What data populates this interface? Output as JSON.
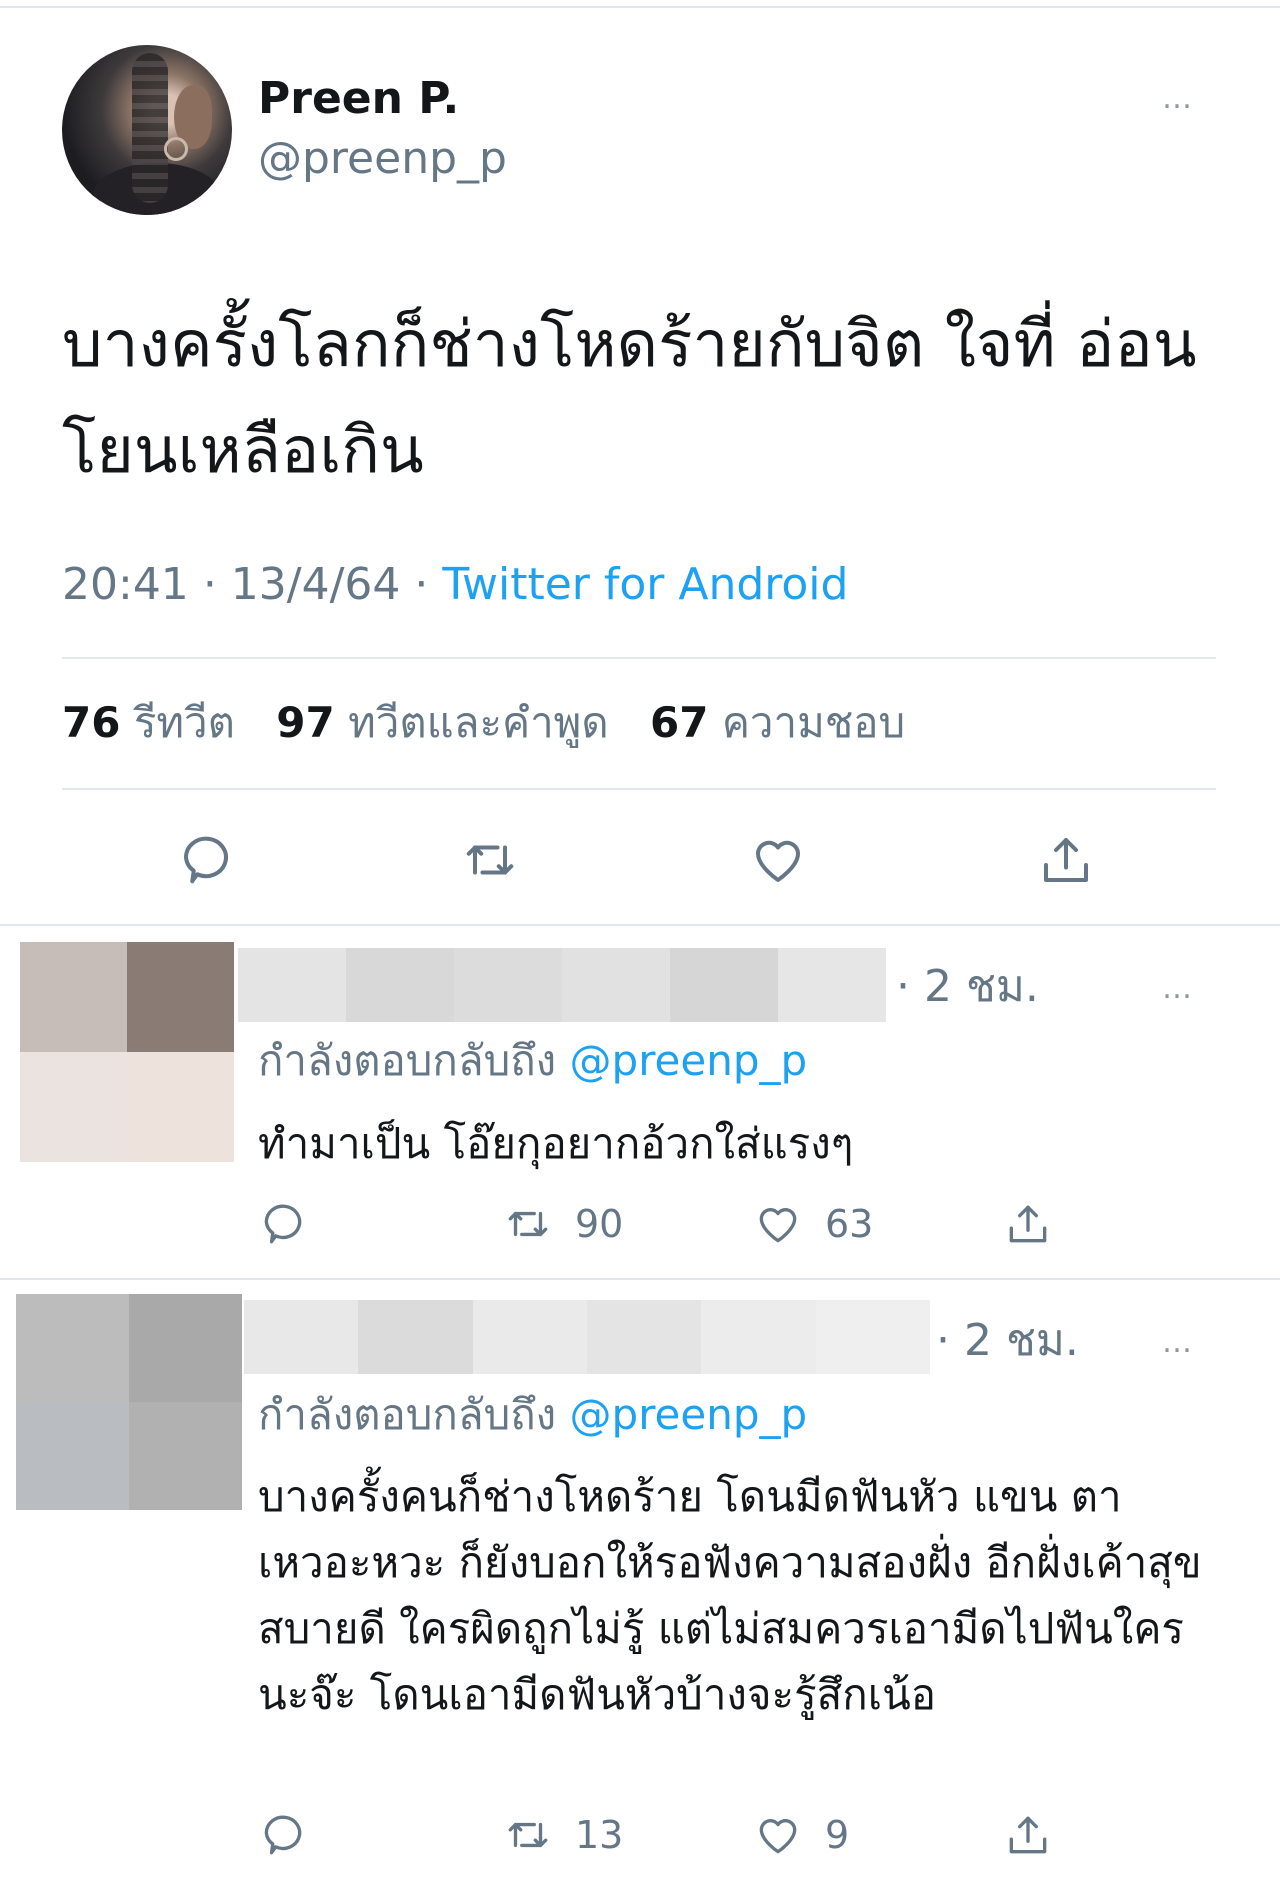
{
  "tweet": {
    "display_name": "Preen P.",
    "handle": "@preenp_p",
    "more_icon": "…",
    "text": "บางครั้งโลกก็ช่างโหดร้ายกับจิต ใจที่ อ่อนโยนเหลือเกิน",
    "time": "20:41",
    "date": "13/4/64",
    "source": "Twitter for Android",
    "stats": {
      "retweets_count": "76",
      "retweets_label": "รีทวีต",
      "quotes_count": "97",
      "quotes_label": "ทวีตและคำพูด",
      "likes_count": "67",
      "likes_label": "ความชอบ"
    },
    "actions": [
      "reply-icon",
      "retweet-icon",
      "like-icon",
      "share-icon"
    ]
  },
  "replies": [
    {
      "time": "2 ชม.",
      "replying_label": "กำลังตอบกลับถึง",
      "replying_to": "@preenp_p",
      "text": "ทำมาเป็น โอ๊ยกุอยากอ้วกใส่แรงๆ",
      "retweets": "90",
      "likes": "63"
    },
    {
      "time": "2 ชม.",
      "replying_label": "กำลังตอบกลับถึง",
      "replying_to": "@preenp_p",
      "text": "บางครั้งคนก็ช่างโหดร้าย โดนมีดฟันหัว แขน ตาเหวอะหวะ ก็ยังบอกให้รอฟังความสองฝั่ง อีกฝั่งเค้าสุขสบายดี ใครผิดถูกไม่รู้ แต่ไม่สมควรเอามีดไปฟันใครนะจ๊ะ โดนเอามีดฟันหัวบ้างจะรู้สึกเน้อ",
      "retweets": "13",
      "likes": "9"
    }
  ],
  "colors": {
    "accent": "#1da1f2",
    "secondary_text": "#657786",
    "divider": "#e1e8ed"
  }
}
